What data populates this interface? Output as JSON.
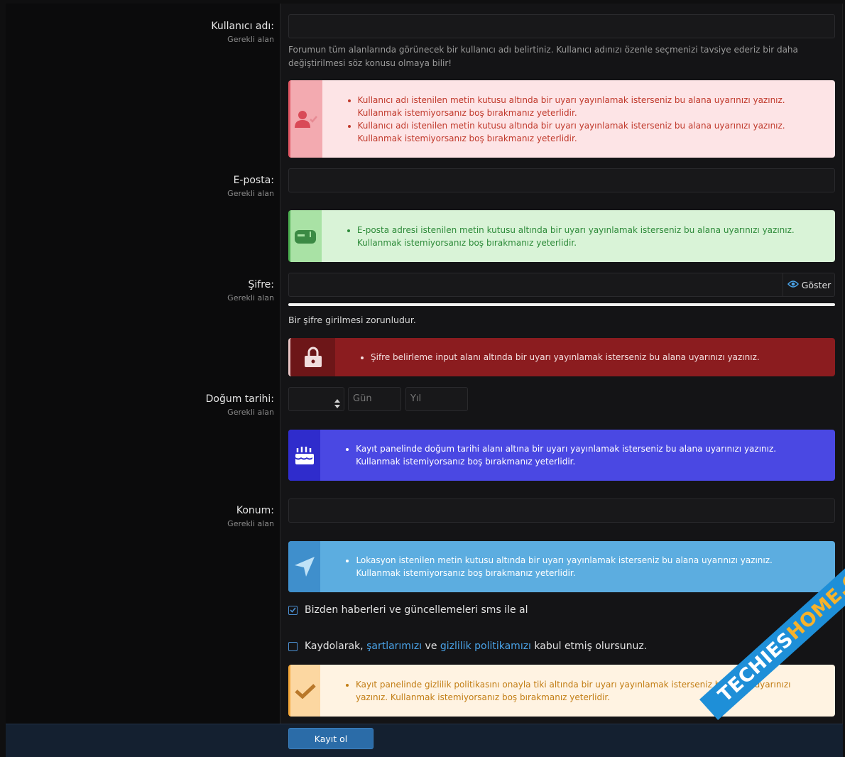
{
  "fields": {
    "username": {
      "label": "Kullanıcı adı:",
      "required": "Gerekli alan",
      "hint": "Forumun tüm alanlarında görünecek bir kullanıcı adı belirtiniz. Kullanıcı adınızı özenle seçmenizi tavsiye ederiz bir daha değiştirilmesi söz konusu olmaya bilir!"
    },
    "email": {
      "label": "E-posta:",
      "required": "Gerekli alan"
    },
    "password": {
      "label": "Şifre:",
      "required": "Gerekli alan",
      "show_label": "Göster",
      "note": "Bir şifre girilmesi zorunludur."
    },
    "birthday": {
      "label": "Doğum tarihi:",
      "required": "Gerekli alan",
      "day_placeholder": "Gün",
      "year_placeholder": "Yıl"
    },
    "location": {
      "label": "Konum:",
      "required": "Gerekli alan"
    }
  },
  "alerts": {
    "username": [
      "Kullanıcı adı istenilen metin kutusu altında bir uyarı yayınlamak isterseniz bu alana uyarınızı yazınız. Kullanmak istemiyorsanız boş bırakmanız yeterlidir.",
      "Kullanıcı adı istenilen metin kutusu altında bir uyarı yayınlamak isterseniz bu alana uyarınızı yazınız. Kullanmak istemiyorsanız boş bırakmanız yeterlidir."
    ],
    "email": "E-posta adresi istenilen metin kutusu altında bir uyarı yayınlamak isterseniz bu alana uyarınızı yazınız. Kullanmak istemiyorsanız boş bırakmanız yeterlidir.",
    "password": "Şifre belirleme input alanı altında bir uyarı yayınlamak isterseniz bu alana uyarınızı yazınız.",
    "birthday": "Kayıt panelinde doğum tarihi alanı altına bir uyarı yayınlamak isterseniz bu alana uyarınızı yazınız. Kullanmak istemiyorsanız boş bırakmanız yeterlidir.",
    "location": "Lokasyon istenilen metin kutusu altında bir uyarı yayınlamak isterseniz bu alana uyarınızı yazınız. Kullanmak istemiyorsanız boş bırakmanız yeterlidir.",
    "privacy": "Kayıt panelinde gizlilik politikasını onayla tiki altında bir uyarı yayınlamak isterseniz bu alana uyarınızı yazınız. Kullanmak istemiyorsanız boş bırakmanız yeterlidir."
  },
  "checkboxes": {
    "sms": {
      "label": "Bizden haberleri ve güncellemeleri sms ile al",
      "checked": true
    },
    "terms": {
      "prefix": "Kaydolarak,",
      "terms_link": "şartlarımızı",
      "middle": "ve",
      "privacy_link": "gizlilik politikamızı",
      "suffix": "kabul etmiş olursunuz.",
      "checked": false
    }
  },
  "submit": {
    "label": "Kayıt ol"
  },
  "watermark": {
    "text_main": "TECHIES",
    "text_accent": "HOME.COM"
  },
  "colors": {
    "link": "#4aa3e8",
    "button": "#2b6ca8"
  }
}
